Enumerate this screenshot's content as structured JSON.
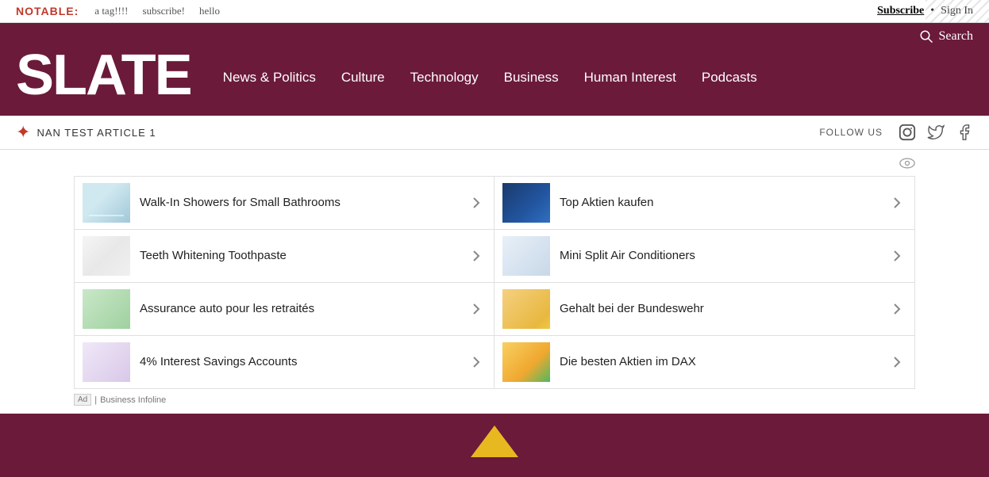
{
  "topbar": {
    "logo": "NOTABLE:",
    "links": [
      "a tag!!!!",
      "subscribe!",
      "hello"
    ],
    "subscribe": "Subscribe",
    "dot": "•",
    "sign_in": "Sign In"
  },
  "header": {
    "search_label": "Search",
    "logo": "SLATE",
    "nav": [
      {
        "label": "News & Politics"
      },
      {
        "label": "Culture"
      },
      {
        "label": "Technology"
      },
      {
        "label": "Business"
      },
      {
        "label": "Human Interest"
      },
      {
        "label": "Podcasts"
      }
    ]
  },
  "subheader": {
    "nan_label": "NAN TEST ARTICLE 1",
    "follow_us": "FOLLOW US"
  },
  "ads": {
    "items": [
      {
        "id": "shower",
        "text": "Walk-In Showers for Small Bathrooms",
        "thumb_class": "thumb-shower"
      },
      {
        "id": "stocks",
        "text": "Top Aktien kaufen",
        "thumb_class": "thumb-stocks"
      },
      {
        "id": "teeth",
        "text": "Teeth Whitening Toothpaste",
        "thumb_class": "thumb-teeth"
      },
      {
        "id": "ac",
        "text": "Mini Split Air Conditioners",
        "thumb_class": "thumb-ac"
      },
      {
        "id": "auto",
        "text": "Assurance auto pour les retraités",
        "thumb_class": "thumb-auto"
      },
      {
        "id": "bundeswehr",
        "text": "Gehalt bei der Bundeswehr",
        "thumb_class": "thumb-bundeswehr"
      },
      {
        "id": "savings",
        "text": "4% Interest Savings Accounts",
        "thumb_class": "thumb-savings"
      },
      {
        "id": "dax",
        "text": "Die besten Aktien im DAX",
        "thumb_class": "thumb-dax"
      }
    ],
    "ad_label": "Ad",
    "provider": "Business Infoline"
  }
}
